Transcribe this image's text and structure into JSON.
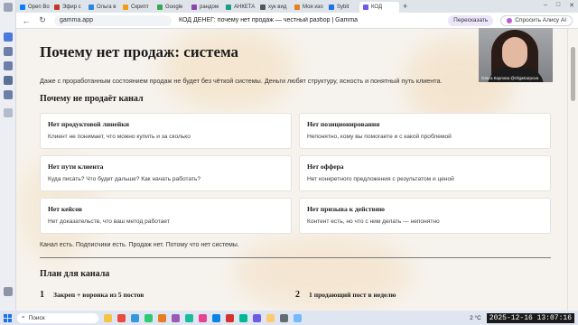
{
  "browser": {
    "tabs": [
      {
        "label": "Open Bo",
        "color": "#0a7cff",
        "active": false
      },
      {
        "label": "Эфир с",
        "color": "#c0392b",
        "active": false
      },
      {
        "label": "Ольга в",
        "color": "#2e86de",
        "active": false
      },
      {
        "label": "Скрипт",
        "color": "#f39c12",
        "active": false
      },
      {
        "label": "Google",
        "color": "#34a853",
        "active": false
      },
      {
        "label": "рандом",
        "color": "#8e44ad",
        "active": false
      },
      {
        "label": "АНКЕТА",
        "color": "#16a085",
        "active": false
      },
      {
        "label": "хук вид",
        "color": "#555555",
        "active": false
      },
      {
        "label": "Моя изо",
        "color": "#e67e22",
        "active": false
      },
      {
        "label": "Sybit",
        "color": "#1a73e8",
        "active": false
      },
      {
        "label": "КОД",
        "color": "#6c5ce7",
        "active": true
      }
    ],
    "new_tab": "+",
    "window_controls": [
      "–",
      "□",
      "✕"
    ],
    "address": "gamma.app",
    "page_title": "КОД ДЕНЕГ: почему нет продаж — честный разбор | Gamma",
    "retell_label": "Пересказать",
    "ask_label": "Спросить Алису AI"
  },
  "doc": {
    "title": "Почему нет продаж: система",
    "intro": "Даже с проработанным состоянием продаж не будет без чёткой системы. Деньги любят структуру, ясность и понятный путь клиента.",
    "section_title": "Почему не продаёт канал",
    "cards": [
      {
        "title": "Нет продуктовой линейки",
        "text": "Клиент не понимает, что можно купить и за сколько"
      },
      {
        "title": "Нет позиционирования",
        "text": "Непонятно, кому вы помогаете и с какой проблемой"
      },
      {
        "title": "Нет пути клиента",
        "text": "Куда писать? Что будет дальше? Как начать работать?"
      },
      {
        "title": "Нет оффера",
        "text": "Нет конкретного предложения с результатом и ценой"
      },
      {
        "title": "Нет кейсов",
        "text": "Нет доказательств, что ваш метод работает"
      },
      {
        "title": "Нет призыва к действию",
        "text": "Контент есть, но что с ним делать — непонятно"
      }
    ],
    "summary": "Канал есть. Подписчики есть. Продаж нет. Потому что нет системы.",
    "plan_title": "План для канала",
    "steps": [
      {
        "num": "1",
        "text": "Закреп + воронка из 5 постов"
      },
      {
        "num": "2",
        "text": "1 продающий пост в неделю"
      }
    ]
  },
  "webcam": {
    "caption": "Ольга Карпова @OlgaKarpova"
  },
  "taskbar": {
    "search_label": "Поиск",
    "weather": "2 °C",
    "clock": "2025-12-16 13:07:16"
  },
  "colors": {
    "accent": "#6c5ce7",
    "page_bg": "#f6f3ee",
    "card_bg": "#ffffff"
  }
}
